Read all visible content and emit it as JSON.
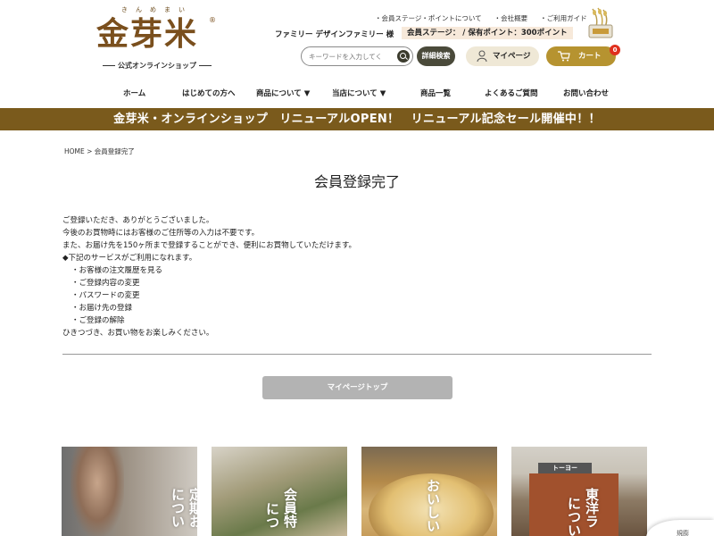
{
  "logo": {
    "ruby": "きんめまい",
    "main": "金芽米",
    "registered": "®",
    "subtitle": "公式オンラインショップ"
  },
  "utility_links": [
    "・会員ステージ・ポイントについて",
    "・会社概要",
    "・ご利用ガイド"
  ],
  "member": {
    "name_line": "ファミリー デザインファミリー 様",
    "stage_line": "会員ステージ：  / 保有ポイント：300ポイント"
  },
  "search": {
    "placeholder": "キーワードを入力してく",
    "detail_label": "詳細検索"
  },
  "mypage_label": "マイページ",
  "cart": {
    "label": "カート",
    "count": "0"
  },
  "nav": [
    "ホーム",
    "はじめての方へ",
    "商品について ▼",
    "当店について ▼",
    "商品一覧",
    "よくあるご質問",
    "お問い合わせ"
  ],
  "banner": "金芽米・オンラインショップ　リニューアルOPEN！　リニューアル記念セール開催中！！",
  "breadcrumb": "HOME > 会員登録完了",
  "page_title": "会員登録完了",
  "message": {
    "lines": [
      "ご登録いただき、ありがとうございました。",
      "今後のお買物時にはお客様のご住所等の入力は不要です。",
      "また、お届け先を150ヶ所まで登録することができ、便利にお買物していただけます。",
      "◆下記のサービスがご利用になれます。"
    ],
    "services": [
      "・お客様の注文履歴を見る",
      "・ご登録内容の変更",
      "・パスワードの変更",
      "・お届け先の登録",
      "・ご登録の解除"
    ],
    "closing": "ひきつづき、お買い物をお楽しみください。"
  },
  "mypage_top_button": "マイページトップ",
  "cards": [
    {
      "text": "定期お届け\nについて"
    },
    {
      "text": "会員特典\nについて"
    },
    {
      "text": "おいしい"
    },
    {
      "text": "東洋ライス\nについて"
    }
  ],
  "card_texts": {
    "card1_a": "定期お",
    "card1_b": "につい",
    "card2_a": "会員特",
    "card2_b": "につ",
    "card3_a": "おいしい",
    "card4_a": "東洋ラ",
    "card4_b": "につい",
    "card4_sign": "トーヨー"
  },
  "side_pop": "規膨"
}
